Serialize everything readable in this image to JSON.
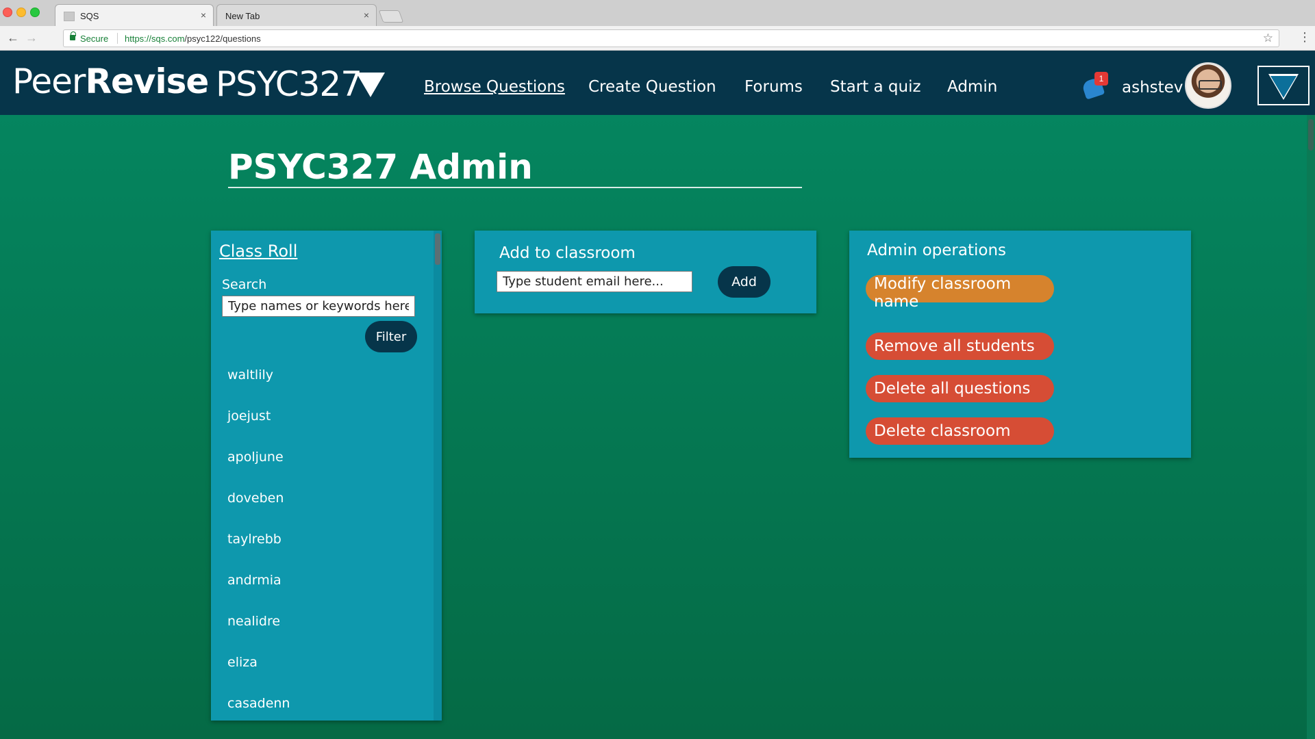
{
  "browser": {
    "tabs": [
      {
        "title": "SQS",
        "active": true
      },
      {
        "title": "New Tab",
        "active": false
      }
    ],
    "secure_label": "Secure",
    "url_host": "https://sqs.com",
    "url_path": "/psyc122/questions"
  },
  "header": {
    "brand_part1": "Peer",
    "brand_part2": "Revise",
    "course": "PSYC327",
    "nav": [
      {
        "label": "Browse Questions",
        "active": true
      },
      {
        "label": "Create Question",
        "active": false
      },
      {
        "label": "Forums",
        "active": false
      },
      {
        "label": "Start a quiz",
        "active": false
      },
      {
        "label": "Admin",
        "active": false
      }
    ],
    "notification_count": "1",
    "username": "ashstev"
  },
  "page": {
    "title": "PSYC327 Admin"
  },
  "class_roll": {
    "title": "Class Roll",
    "search_label": "Search",
    "search_placeholder": "Type names or keywords here...",
    "filter_label": "Filter",
    "students": [
      "waltlily",
      "joejust",
      "apoljune",
      "doveben",
      "taylrebb",
      "andrmia",
      "nealidre",
      "eliza",
      "casadenn"
    ]
  },
  "add_to_classroom": {
    "title": "Add to classroom",
    "email_placeholder": "Type student email here...",
    "add_label": "Add"
  },
  "admin_operations": {
    "title": "Admin operations",
    "modify_label": "Modify classroom name",
    "remove_label": "Remove all students",
    "delete_questions_label": "Delete all questions",
    "delete_classroom_label": "Delete classroom"
  },
  "colors": {
    "header_bg": "#06354a",
    "panel_bg": "#0e98ad",
    "background_green": "#05855f",
    "modify_orange": "#d6832d",
    "danger_red": "#d64d35"
  }
}
